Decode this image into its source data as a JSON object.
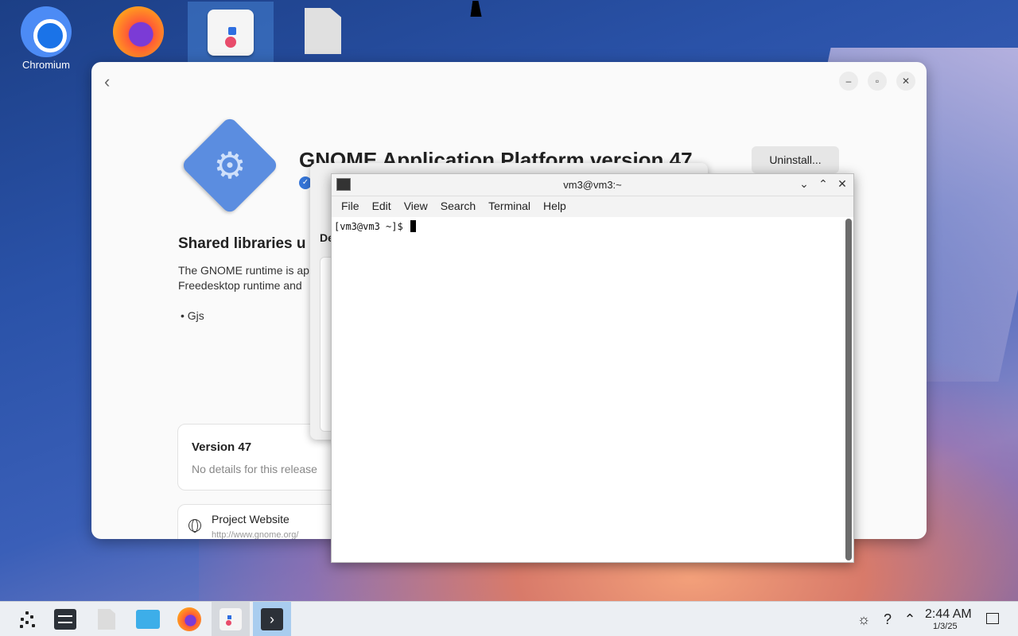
{
  "desktop": {
    "icons": [
      {
        "label": "Chromium",
        "icon": "chromium-icon"
      },
      {
        "label": "",
        "icon": "firefox-icon"
      },
      {
        "label": "",
        "icon": "software-store-icon"
      },
      {
        "label": "",
        "icon": "file-icon"
      }
    ]
  },
  "software_window": {
    "app_title": "GNOME Application Platform version 47",
    "uninstall_label": "Uninstall...",
    "description_heading": "Shared libraries u",
    "description_lines": [
      "The GNOME runtime is ap",
      "Freedesktop runtime and"
    ],
    "bullet": "• Gjs",
    "version_title": "Version 47",
    "version_note": "No details for this release",
    "project_label": "Project Website",
    "project_url": "http://www.gnome.org/"
  },
  "background_dialog": {
    "heading_fragment": "De"
  },
  "terminal": {
    "title": "vm3@vm3:~",
    "menu": [
      "File",
      "Edit",
      "View",
      "Search",
      "Terminal",
      "Help"
    ],
    "prompt": "[vm3@vm3 ~]$ "
  },
  "taskbar": {
    "items": [
      {
        "icon": "app-launcher-icon",
        "state": "normal"
      },
      {
        "icon": "system-settings-icon",
        "state": "normal"
      },
      {
        "icon": "document-icon",
        "state": "normal"
      },
      {
        "icon": "file-manager-icon",
        "state": "normal"
      },
      {
        "icon": "firefox-icon",
        "state": "normal"
      },
      {
        "icon": "software-store-icon",
        "state": "active"
      },
      {
        "icon": "terminal-icon",
        "state": "current"
      }
    ],
    "tray": [
      "brightness-icon",
      "help-icon",
      "expand-tray-icon"
    ],
    "clock": {
      "time": "2:44 AM",
      "date": "1/3/25"
    }
  },
  "colors": {
    "accent": "#3daee9",
    "taskbar_active": "#a9cdef",
    "desktop_selection": "#4682d2"
  }
}
